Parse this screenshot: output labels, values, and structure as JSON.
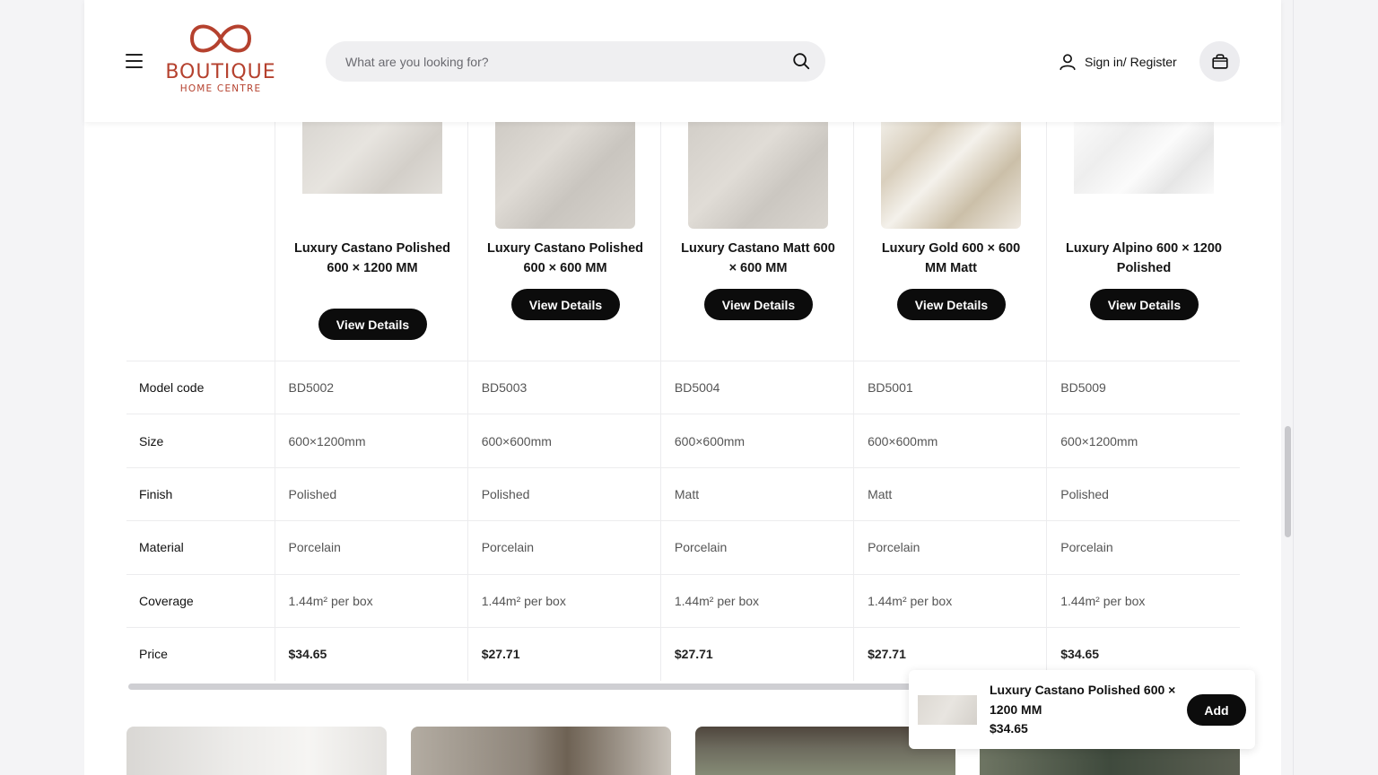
{
  "header": {
    "logo": {
      "brand": "BOUTIQUE",
      "sub": "HOME CENTRE",
      "color": "#b5412e"
    },
    "search": {
      "placeholder": "What are you looking for?"
    },
    "signin_label": "Sign in/ Register"
  },
  "products": [
    {
      "name": "Luxury Castano Polished 600 × 1200 MM",
      "button": "View Details"
    },
    {
      "name": "Luxury Castano Polished 600 × 600 MM",
      "button": "View Details"
    },
    {
      "name": "Luxury Castano Matt 600 × 600 MM",
      "button": "View Details"
    },
    {
      "name": "Luxury Gold 600 × 600 MM Matt",
      "button": "View Details"
    },
    {
      "name": "Luxury Alpino 600 × 1200 Polished",
      "button": "View Details"
    }
  ],
  "specs": [
    {
      "label": "Model code",
      "values": [
        "BD5002",
        "BD5003",
        "BD5004",
        "BD5001",
        "BD5009"
      ]
    },
    {
      "label": "Size",
      "values": [
        "600×1200mm",
        "600×600mm",
        "600×600mm",
        "600×600mm",
        "600×1200mm"
      ]
    },
    {
      "label": "Finish",
      "values": [
        "Polished",
        "Polished",
        "Matt",
        "Matt",
        "Polished"
      ]
    },
    {
      "label": "Material",
      "values": [
        "Porcelain",
        "Porcelain",
        "Porcelain",
        "Porcelain",
        "Porcelain"
      ]
    },
    {
      "label": "Coverage",
      "values": [
        "1.44m² per box",
        "1.44m² per box",
        "1.44m² per box",
        "1.44m² per box",
        "1.44m² per box"
      ]
    },
    {
      "label": "Price",
      "values": [
        "$34.65",
        "$27.71",
        "$27.71",
        "$27.71",
        "$34.65"
      ]
    }
  ],
  "sticky": {
    "name": "Luxury Castano Polished 600 × 1200 MM",
    "price": "$34.65",
    "add_label": "Add"
  }
}
